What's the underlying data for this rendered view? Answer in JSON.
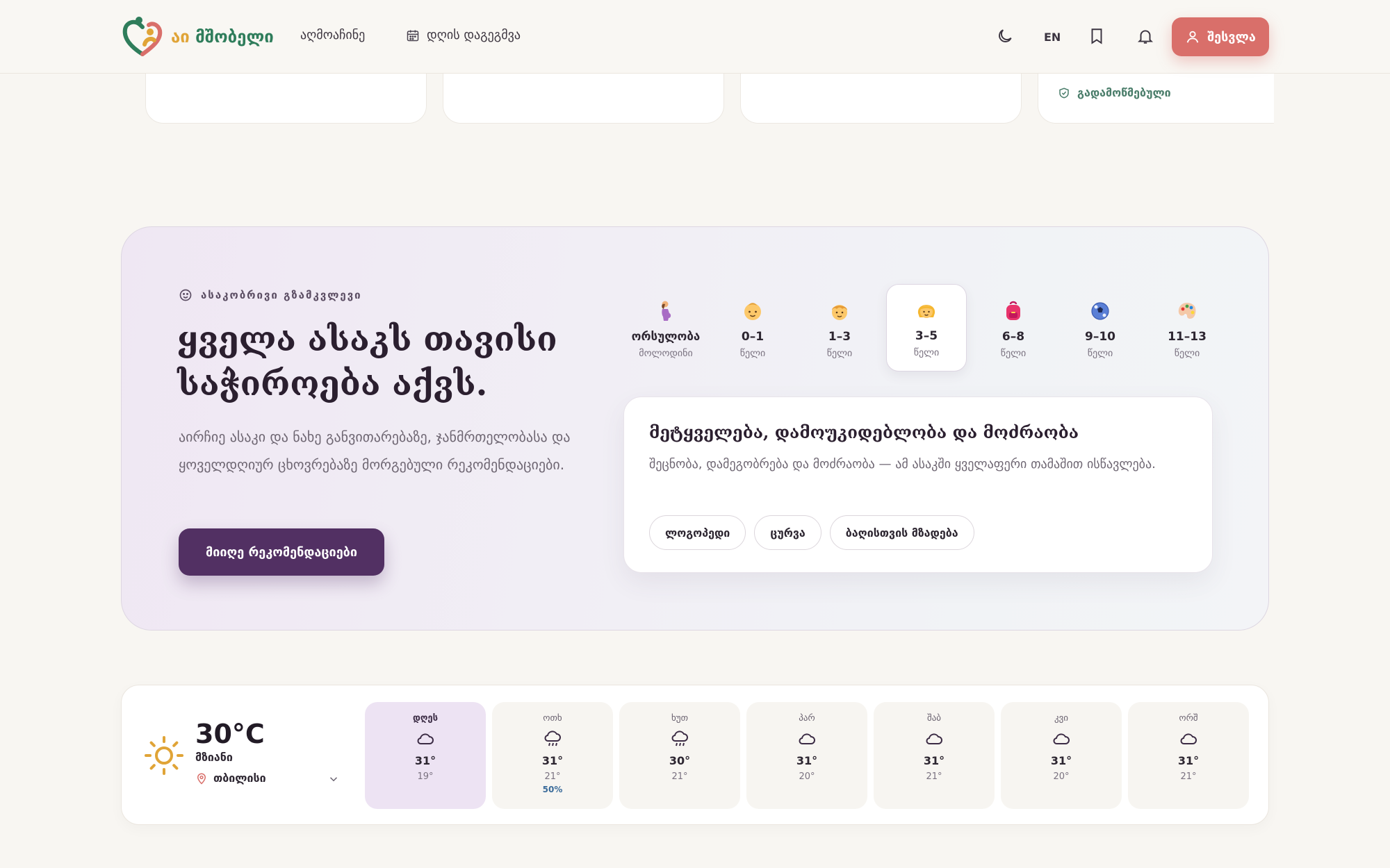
{
  "header": {
    "logo_text_a": "აი",
    "logo_text_b": "მშობელი",
    "nav": [
      "აღმოაჩინე",
      "დღის დაგეგმვა"
    ],
    "lang": "EN",
    "login_label": "შესვლა"
  },
  "top_strip": {
    "verified_label": "გადამოწმებული"
  },
  "age_guide": {
    "eyebrow": "ასაკობრივი გზამკვლევი",
    "title": "ყველა ასაკს თავისი საჭიროება აქვს.",
    "subtitle": "აირჩიე ასაკი და ნახე განვითარებაზე, ჯანმრთელობასა და ყოველდღიურ ცხოვრებაზე მორგებული რეკომენდაციები.",
    "cta": "მიიღე რეკომენდაციები",
    "tabs": [
      {
        "label": "ორსულობა",
        "unit": "მოლოდინი",
        "icon": "pregnant-person-icon",
        "active": false
      },
      {
        "label": "0–1",
        "unit": "წელი",
        "icon": "baby-face-icon",
        "active": false
      },
      {
        "label": "1–3",
        "unit": "წელი",
        "icon": "child-face-icon",
        "active": false
      },
      {
        "label": "3–5",
        "unit": "წელი",
        "icon": "girl-face-icon",
        "active": true
      },
      {
        "label": "6–8",
        "unit": "წელი",
        "icon": "backpack-icon",
        "active": false
      },
      {
        "label": "9–10",
        "unit": "წელი",
        "icon": "soccer-ball-icon",
        "active": false
      },
      {
        "label": "11–13",
        "unit": "წელი",
        "icon": "palette-icon",
        "active": false
      }
    ],
    "card": {
      "title": "მეტყველება, დამოუკიდებლობა და მოძრაობა",
      "description": "შეცნობა, დამეგობრება და მოძრაობა — ამ ასაკში ყველაფერი თამაშით ისწავლება.",
      "chips": [
        "ლოგოპედი",
        "ცურვა",
        "ბაღისთვის მზადება"
      ]
    }
  },
  "weather": {
    "current_temp": "30°C",
    "current_condition": "მზიანი",
    "city": "თბილისი",
    "days": [
      {
        "name": "დღეს",
        "hi": "31°",
        "lo": "19°",
        "icon": "cloud-icon",
        "today": true
      },
      {
        "name": "ოთხ",
        "hi": "31°",
        "lo": "21°",
        "rain": "50%",
        "icon": "rain-cloud-icon"
      },
      {
        "name": "ხუთ",
        "hi": "30°",
        "lo": "21°",
        "icon": "rain-cloud-icon"
      },
      {
        "name": "პარ",
        "hi": "31°",
        "lo": "20°",
        "icon": "cloud-icon"
      },
      {
        "name": "შაბ",
        "hi": "31°",
        "lo": "21°",
        "icon": "cloud-icon"
      },
      {
        "name": "კვი",
        "hi": "31°",
        "lo": "20°",
        "icon": "cloud-icon"
      },
      {
        "name": "ორშ",
        "hi": "31°",
        "lo": "21°",
        "icon": "cloud-icon"
      }
    ]
  },
  "colors": {
    "brand_green": "#2f7d5b",
    "brand_gold": "#e0a437",
    "login_coral": "#d96f6a",
    "cta_purple": "#523063"
  }
}
